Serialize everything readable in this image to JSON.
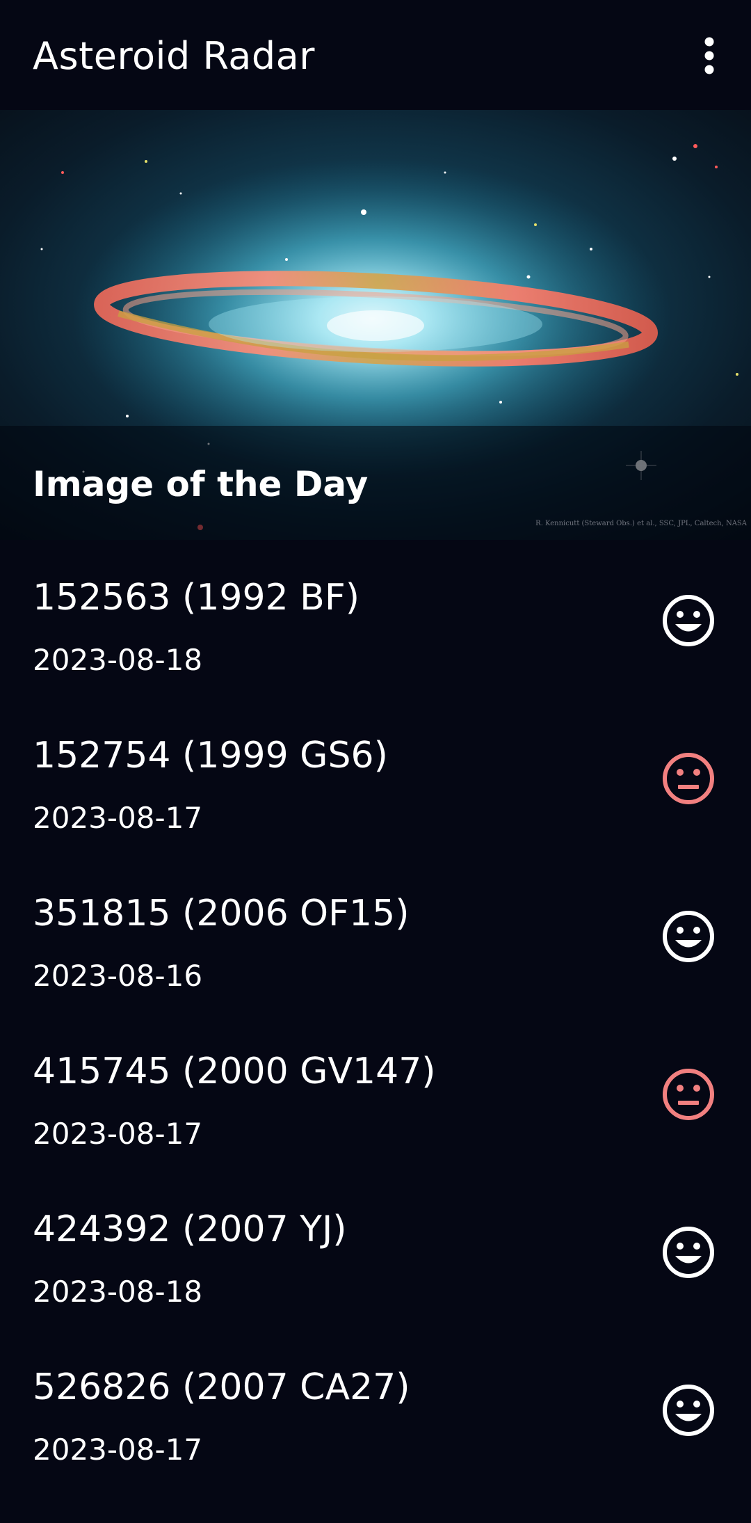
{
  "app_bar": {
    "title": "Asteroid Radar",
    "overflow_icon": "more-vert-icon"
  },
  "image_of_the_day": {
    "title": "Image of the Day",
    "credit": "R. Kennicutt (Steward Obs.) et al., SSC, JPL, Caltech, NASA"
  },
  "colors": {
    "background": "#050714",
    "safe": "#ffffff",
    "hazardous": "#f28080"
  },
  "asteroids": [
    {
      "code": "152563 (1992 BF)",
      "date": "2023-08-18",
      "status": "safe",
      "icon": "happy-face-icon"
    },
    {
      "code": "152754 (1999 GS6)",
      "date": "2023-08-17",
      "status": "hazardous",
      "icon": "neutral-face-icon"
    },
    {
      "code": "351815 (2006 OF15)",
      "date": "2023-08-16",
      "status": "safe",
      "icon": "happy-face-icon"
    },
    {
      "code": "415745 (2000 GV147)",
      "date": "2023-08-17",
      "status": "hazardous",
      "icon": "neutral-face-icon"
    },
    {
      "code": "424392 (2007 YJ)",
      "date": "2023-08-18",
      "status": "safe",
      "icon": "happy-face-icon"
    },
    {
      "code": "526826 (2007 CA27)",
      "date": "2023-08-17",
      "status": "safe",
      "icon": "happy-face-icon"
    }
  ]
}
